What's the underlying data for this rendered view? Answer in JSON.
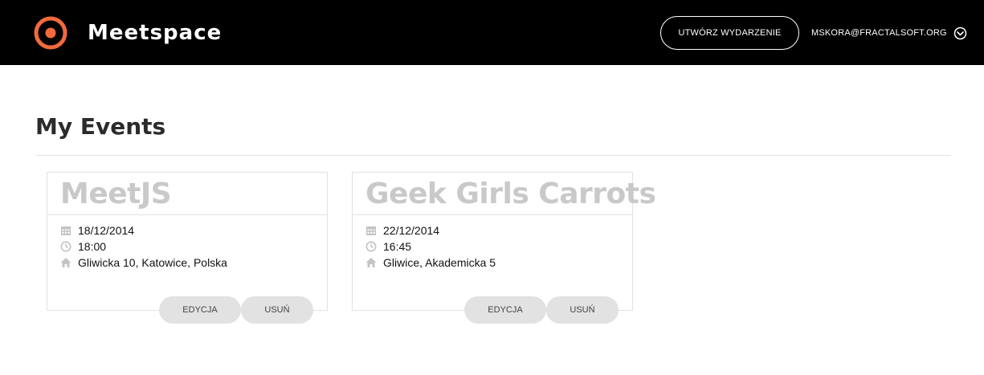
{
  "header": {
    "brand": "Meetspace",
    "create_event_label": "UTWÓRZ WYDARZENIE",
    "user_email": "MSKORA@FRACTALSOFT.ORG",
    "brand_color": "#f26a3d",
    "background": "#000000"
  },
  "main": {
    "title": "My Events"
  },
  "events": [
    {
      "title": "MeetJS",
      "date": "18/12/2014",
      "time": "18:00",
      "location": "Gliwicka 10, Katowice, Polska",
      "edit_label": "EDYCJA",
      "delete_label": "USUŃ"
    },
    {
      "title": "Geek Girls Carrots",
      "date": "22/12/2014",
      "time": "16:45",
      "location": "Gliwice, Akademicka 5",
      "edit_label": "EDYCJA",
      "delete_label": "USUŃ"
    }
  ],
  "icons": {
    "logo": "target-logo-icon",
    "user_menu": "chevron-down-circle-icon",
    "date": "calendar-icon",
    "time": "clock-icon",
    "location": "home-icon"
  }
}
